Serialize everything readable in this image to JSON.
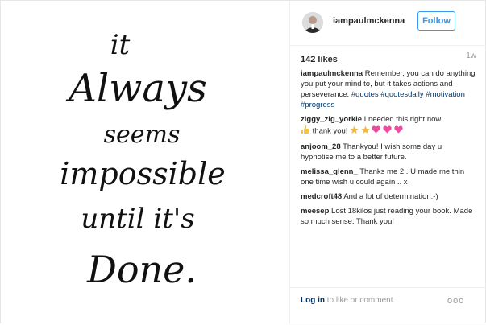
{
  "image": {
    "quote_lines": [
      "it",
      "Always",
      "seems",
      "impossible",
      "until it's",
      "Done."
    ]
  },
  "header": {
    "username": "iampaulmckenna",
    "follow_label": "Follow"
  },
  "meta": {
    "likes": "142 likes",
    "time": "1w"
  },
  "caption": {
    "user": "iampaulmckenna",
    "text": "Remember, you can do anything you put your mind to, but it takes actions and perseverance.",
    "tags": [
      "#quotes",
      "#quotesdaily",
      "#motivation",
      "#progress"
    ]
  },
  "comments": [
    {
      "user": "ziggy_zig_yorkie",
      "text": "I needed this right now",
      "emoji_line": "thank you!"
    },
    {
      "user": "anjoom_28",
      "text": "Thankyou! I wish some day u hypnotise me to a better future."
    },
    {
      "user": "melissa_glenn_",
      "text": "Thanks me 2 . U made me thin one time wish u could again .. x"
    },
    {
      "user": "medcroft48",
      "text": "And a lot of determination:-)"
    },
    {
      "user": "meesep",
      "text": "Lost 18kilos just reading your book. Made so much sense. Thank you!"
    }
  ],
  "footer": {
    "login_link": "Log in",
    "login_rest": "to like or comment.",
    "more": "ooo"
  },
  "icons": {
    "avatar": "profile-avatar",
    "thumbs": "thumbs-up-icon",
    "stars": "star-icon",
    "hearts": "heart-icon"
  },
  "colors": {
    "follow": "#3897f0",
    "hashtag": "#003569",
    "muted": "#999999",
    "heart": "#ed4b9d",
    "star": "#f6b93b",
    "thumb": "#f4c542"
  }
}
